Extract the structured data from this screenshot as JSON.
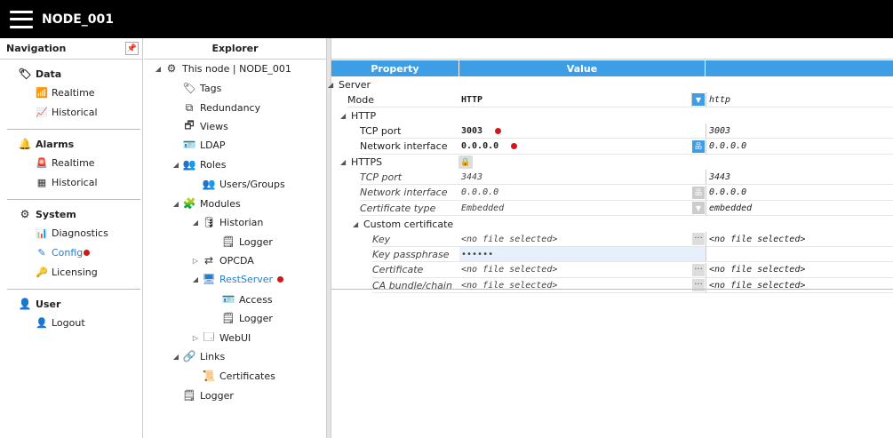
{
  "app": {
    "title": "NODE_001"
  },
  "navigation": {
    "title": "Navigation",
    "sections": [
      {
        "label": "Data",
        "icon": "tag-icon",
        "items": [
          {
            "label": "Realtime",
            "icon": "rss-icon"
          },
          {
            "label": "Historical",
            "icon": "line-chart-icon"
          }
        ]
      },
      {
        "label": "Alarms",
        "icon": "bell-icon",
        "items": [
          {
            "label": "Realtime",
            "icon": "alarm-icon"
          },
          {
            "label": "Historical",
            "icon": "table-icon"
          }
        ]
      },
      {
        "label": "System",
        "icon": "gear-icon",
        "items": [
          {
            "label": "Diagnostics",
            "icon": "monitor-icon"
          },
          {
            "label": "Config",
            "icon": "edit-icon",
            "active": true,
            "alert": true
          },
          {
            "label": "Licensing",
            "icon": "key-icon"
          }
        ]
      },
      {
        "label": "User",
        "icon": "user-icon",
        "items": [
          {
            "label": "Logout",
            "icon": "logout-user-icon"
          }
        ]
      }
    ]
  },
  "explorer": {
    "title": "Explorer",
    "items": [
      {
        "label": "This node | NODE_001",
        "icon": "node-gears-icon",
        "toggle": "expanded"
      },
      {
        "label": "Tags",
        "icon": "tag-icon"
      },
      {
        "label": "Redundancy",
        "icon": "redundancy-icon"
      },
      {
        "label": "Views",
        "icon": "views-icon"
      },
      {
        "label": "LDAP",
        "icon": "ldap-icon"
      },
      {
        "label": "Roles",
        "icon": "roles-icon",
        "toggle": "expanded"
      },
      {
        "label": "Users/Groups",
        "icon": "users-icon"
      },
      {
        "label": "Modules",
        "icon": "modules-icon",
        "toggle": "expanded"
      },
      {
        "label": "Historian",
        "icon": "database-icon",
        "toggle": "expanded"
      },
      {
        "label": "Logger",
        "icon": "logger-icon"
      },
      {
        "label": "OPCDA",
        "icon": "opcda-icon",
        "toggle": "collapsed"
      },
      {
        "label": "RestServer",
        "icon": "server-icon",
        "toggle": "expanded",
        "active": true,
        "alert": true
      },
      {
        "label": "Access",
        "icon": "access-card-icon"
      },
      {
        "label": "Logger",
        "icon": "logger-icon"
      },
      {
        "label": "WebUI",
        "icon": "window-icon",
        "toggle": "collapsed"
      },
      {
        "label": "Links",
        "icon": "link-icon",
        "toggle": "expanded"
      },
      {
        "label": "Certificates",
        "icon": "certificate-icon"
      },
      {
        "label": "Logger",
        "icon": "logger-icon"
      }
    ]
  },
  "property_grid": {
    "headers": {
      "property": "Property",
      "value": "Value",
      "default": ""
    },
    "rows": [
      {
        "kind": "category",
        "label": "Server"
      },
      {
        "kind": "prop",
        "label": "Mode",
        "value": "HTTP",
        "default": "http",
        "button": "dropdown",
        "value_bold": true
      },
      {
        "kind": "category",
        "label": "HTTP"
      },
      {
        "kind": "prop",
        "label": "TCP port",
        "value": "3003",
        "default": "3003",
        "value_bold": true,
        "alert": true
      },
      {
        "kind": "prop",
        "label": "Network interface",
        "value": "0.0.0.0",
        "default": "0.0.0.0",
        "value_bold": true,
        "alert": true,
        "button": "network"
      },
      {
        "kind": "category",
        "label": "HTTPS",
        "locked": true
      },
      {
        "kind": "prop",
        "label": "TCP port",
        "value": "3443",
        "default": "3443",
        "italic": true
      },
      {
        "kind": "prop",
        "label": "Network interface",
        "value": "0.0.0.0",
        "default": "0.0.0.0",
        "italic": true,
        "button": "network-disabled"
      },
      {
        "kind": "prop",
        "label": "Certificate type",
        "value": "Embedded",
        "default": "embedded",
        "italic": true,
        "button": "dropdown-disabled"
      },
      {
        "kind": "category",
        "label": "Custom certificate"
      },
      {
        "kind": "prop",
        "label": "Key",
        "value": "<no file selected>",
        "default": "<no file selected>",
        "italic": true,
        "button": "dots"
      },
      {
        "kind": "prop",
        "label": "Key passphrase",
        "value": "••••••",
        "default": "",
        "italic": true,
        "selected": true
      },
      {
        "kind": "prop",
        "label": "Certificate",
        "value": "<no file selected>",
        "default": "<no file selected>",
        "italic": true,
        "button": "dots"
      },
      {
        "kind": "prop",
        "label": "CA bundle/chain",
        "value": "<no file selected>",
        "default": "<no file selected>",
        "italic": true,
        "button": "dots"
      }
    ]
  }
}
